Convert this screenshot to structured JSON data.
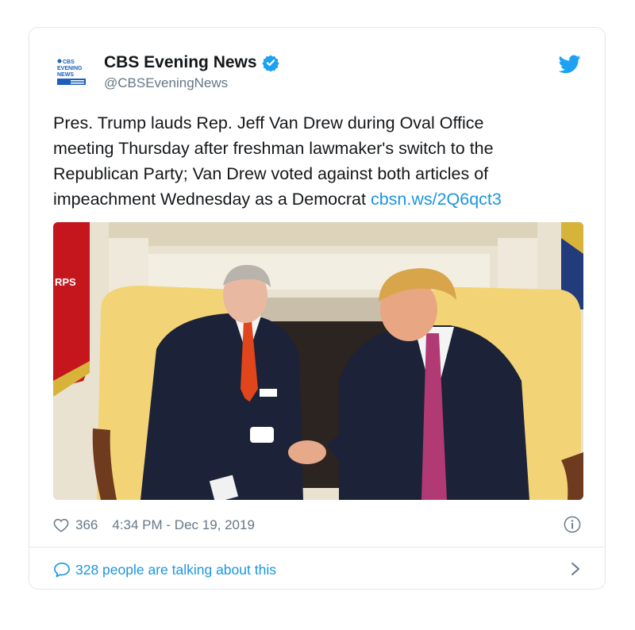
{
  "account": {
    "display_name": "CBS Evening News",
    "handle": "@CBSEveningNews",
    "verified": true,
    "avatar_text": "CBS EVENING NEWS"
  },
  "tweet": {
    "lines": [
      "Pres. Trump lauds Rep. Jeff Van Drew during Oval Office",
      "meeting Thursday after freshman lawmaker's switch to the",
      "Republican Party; Van Drew voted against both articles of",
      "impeachment Wednesday as a Democrat "
    ],
    "link_text": "cbsn.ws/2Q6qct3"
  },
  "photo": {
    "flag_text": "RPS",
    "alt": "Two men in dark suits shaking hands while seated in yellow chairs in front of a fireplace"
  },
  "footer": {
    "likes": "366",
    "timestamp": "4:34 PM - Dec 19, 2019"
  },
  "conversation": {
    "label": "328 people are talking about this"
  },
  "colors": {
    "link": "#1b95e0",
    "text": "#14171a",
    "muted": "#657786",
    "border": "#e1e8ed"
  }
}
